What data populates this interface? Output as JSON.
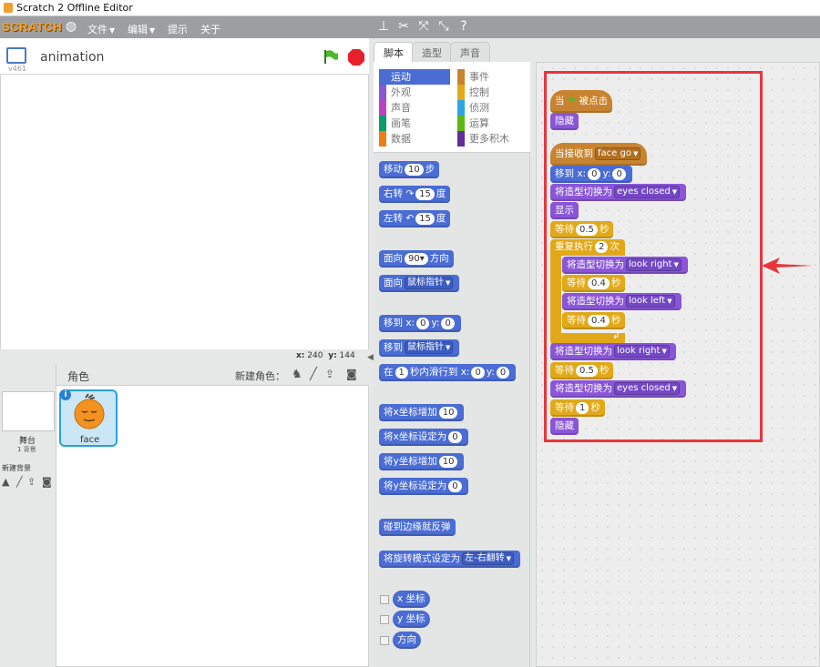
{
  "window": {
    "title": "Scratch 2 Offline Editor"
  },
  "menubar": {
    "logo": "SCRATCH",
    "items": [
      "文件",
      "编辑",
      "提示",
      "关于"
    ]
  },
  "stage": {
    "project_name": "animation",
    "version": "v461",
    "x_label": "x:",
    "x_value": "240",
    "y_label": "y:",
    "y_value": "144"
  },
  "sprites": {
    "header": "角色",
    "new_sprite_label": "新建角色：",
    "stage_label": "舞台",
    "stage_backdrops": "1 背景",
    "new_backdrop_label": "新建背景",
    "sprite_name": "face"
  },
  "tabs": [
    "脚本",
    "造型",
    "声音"
  ],
  "categories": {
    "left": [
      {
        "label": "运动",
        "color": "#4a6cd4",
        "active": true
      },
      {
        "label": "外观",
        "color": "#8a55d7"
      },
      {
        "label": "声音",
        "color": "#bb42c3"
      },
      {
        "label": "画笔",
        "color": "#0e9a6c"
      },
      {
        "label": "数据",
        "color": "#ee7d16"
      }
    ],
    "right": [
      {
        "label": "事件",
        "color": "#c88330"
      },
      {
        "label": "控制",
        "color": "#e1a91a"
      },
      {
        "label": "侦测",
        "color": "#2ca5e2"
      },
      {
        "label": "运算",
        "color": "#5cb712"
      },
      {
        "label": "更多积木",
        "color": "#632d99"
      }
    ]
  },
  "palette": {
    "move": "移动",
    "move_n": "10",
    "steps": "步",
    "turn_right": "右转",
    "turn_right_n": "15",
    "degree": "度",
    "turn_left": "左转",
    "turn_left_n": "15",
    "point_dir": "面向",
    "point_dir_n": "90▾",
    "direction": "方向",
    "point_towards": "面向",
    "mouse_pointer": "鼠标指针",
    "goto_xy": "移到",
    "x": "x:",
    "y": "y:",
    "zero": "0",
    "goto": "移到",
    "glide_in": "在",
    "glide_n": "1",
    "glide_text": "秒内滑行到",
    "change_x": "将x坐标增加",
    "change_x_n": "10",
    "set_x": "将x坐标设定为",
    "set_x_n": "0",
    "change_y": "将y坐标增加",
    "change_y_n": "10",
    "set_y": "将y坐标设定为",
    "set_y_n": "0",
    "bounce": "碰到边缘就反弹",
    "rotation_style": "将旋转模式设定为",
    "rotation_value": "左-右翻转",
    "x_position": "x 坐标",
    "y_position": "y 坐标",
    "direction_rep": "方向"
  },
  "script": {
    "when": "当",
    "clicked": "被点击",
    "hide": "隐藏",
    "when_receive": "当接收到",
    "message": "face go",
    "goto": "移到",
    "x": "x:",
    "x_val": "0",
    "y": "y:",
    "y_val": "0",
    "switch_costume": "将造型切换为",
    "costume_eyes_closed": "eyes closed",
    "costume_look_right": "look right",
    "costume_look_left": "look left",
    "show": "显示",
    "wait": "等待",
    "seconds": "秒",
    "wait_1": "0.5",
    "repeat": "重复执行",
    "repeat_n": "2",
    "times": "次",
    "inner_wait_1": "0.4",
    "inner_wait_2": "0.4",
    "wait_2": "0.5",
    "wait_3": "1"
  }
}
